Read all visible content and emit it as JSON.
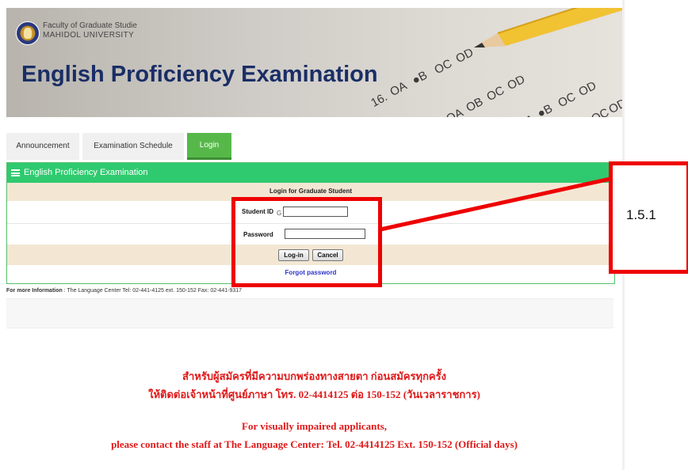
{
  "header": {
    "faculty_line1": "Faculty of Graduate Studie",
    "faculty_line2": "MAHIDOL UNIVERSITY",
    "title": "English Proficiency Examination",
    "sheet_marks": [
      "16.",
      "OA",
      "●B",
      "OC",
      "OD",
      "OA",
      "OB",
      "OC",
      "OD",
      "OA",
      "●B",
      "OC",
      "OD",
      "OC",
      "OD"
    ]
  },
  "tabs": [
    {
      "label": "Announcement",
      "active": false
    },
    {
      "label": "Examination Schedule",
      "active": false
    },
    {
      "label": "Login",
      "active": true
    }
  ],
  "panel": {
    "title": "English Proficiency Examination",
    "icon": "list-icon",
    "caption": "Login for Graduate Student",
    "student_id_label": "Student ID",
    "student_id_prefix": "G",
    "student_id_value": "",
    "password_label": "Password",
    "password_value": "",
    "login_button": "Log-in",
    "cancel_button": "Cancel",
    "forgot_link": "Forgot password"
  },
  "more_info": {
    "label": "For more Information",
    "text": " : The Language Center Tel: 02-441-4125 ext. 150-152 Fax: 02-441-9317"
  },
  "notice": {
    "thai_line1": "สำหรับผู้สมัครที่มีความบกพร่องทางสายตา ก่อนสมัครทุกครั้ง",
    "thai_line2": "ให้ติดต่อเจ้าหน้าที่ศูนย์ภาษา โทร. 02-4414125 ต่อ 150-152 (วันเวลาราชการ)",
    "en_line1": "For visually impaired applicants,",
    "en_line2": "please contact the staff at The Language Center: Tel. 02-4414125 Ext. 150-152 (Official days)"
  },
  "annotation": {
    "label": "1.5.1",
    "color": "#ee0000"
  },
  "colors": {
    "tab_active": "#57b84a",
    "panel_header": "#2fca6f",
    "row_shade": "#f3e7d4",
    "title_blue": "#1a2e66",
    "notice_red": "#e01919",
    "link_blue": "#2b34c9"
  }
}
